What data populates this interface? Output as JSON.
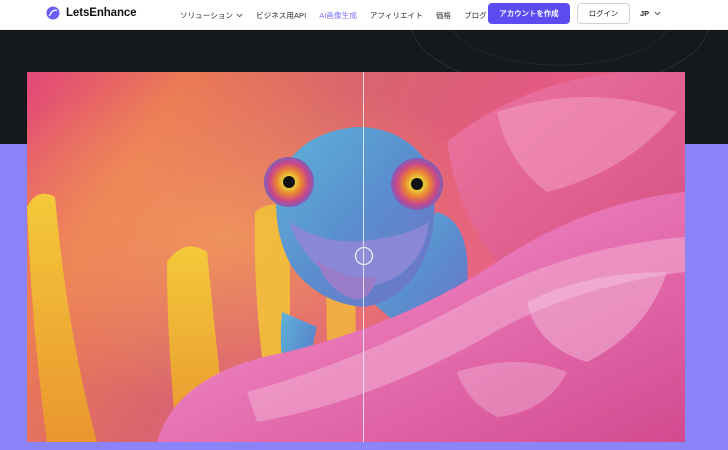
{
  "brand": {
    "name": "LetsEnhance",
    "color": "#6b5cf6"
  },
  "nav": {
    "items": [
      {
        "label": "ソリューション",
        "has_dropdown": true
      },
      {
        "label": "ビジネス用API",
        "has_dropdown": false
      },
      {
        "label": "AI画像生成",
        "has_dropdown": false,
        "active": true
      },
      {
        "label": "アフィリエイト",
        "has_dropdown": false
      },
      {
        "label": "価格",
        "has_dropdown": false
      },
      {
        "label": "ブログ",
        "has_dropdown": false
      }
    ]
  },
  "actions": {
    "signup_label": "アカウントを作成",
    "login_label": "ログイン",
    "language_label": "JP"
  },
  "showcase": {
    "comparison_slider_position": 0.52,
    "subject": "chameleon-on-flower-image"
  },
  "colors": {
    "accent": "#5a4cf0",
    "active_nav": "#7b73ff",
    "hero_dark": "#15181d",
    "hero_purple": "#8b84f8"
  }
}
